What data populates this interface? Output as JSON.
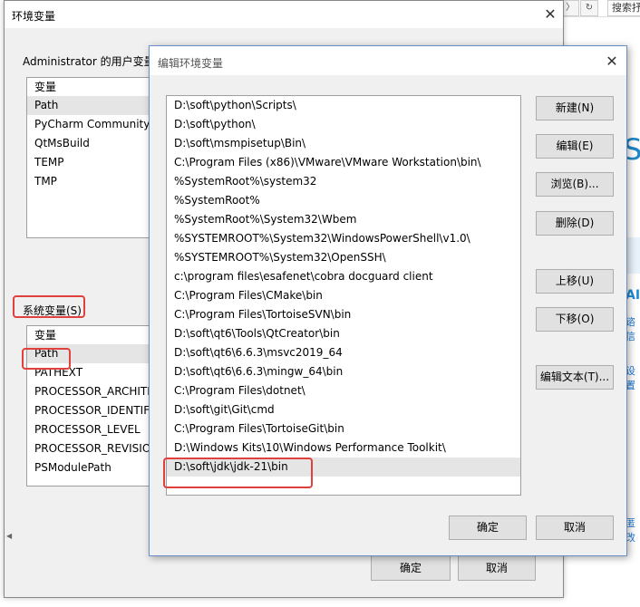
{
  "background": {
    "back_glyph": "〉",
    "refresh_glyph": "↻",
    "search_text": "搜索抒",
    "big_letter": "S",
    "ai_text": "AI",
    "link1": "谘信",
    "link2": "设置",
    "link3": "匿改"
  },
  "outer_dialog": {
    "title": "环境变量",
    "user_section_label": "Administrator 的用户变量",
    "user_vars_header": "变量",
    "user_vars": [
      "Path",
      "PyCharm Community E",
      "QtMsBuild",
      "TEMP",
      "TMP"
    ],
    "system_section_label": "系统变量(S)",
    "system_vars_header": "变量",
    "system_vars": [
      "Path",
      "PATHEXT",
      "PROCESSOR_ARCHITE",
      "PROCESSOR_IDENTIFI",
      "PROCESSOR_LEVEL",
      "PROCESSOR_REVISION",
      "PSModulePath"
    ],
    "ok_label": "确定",
    "cancel_label": "取消"
  },
  "edit_dialog": {
    "title": "编辑环境变量",
    "paths": [
      "D:\\soft\\python\\Scripts\\",
      "D:\\soft\\python\\",
      "D:\\soft\\msmpisetup\\Bin\\",
      "C:\\Program Files (x86)\\VMware\\VMware Workstation\\bin\\",
      "%SystemRoot%\\system32",
      "%SystemRoot%",
      "%SystemRoot%\\System32\\Wbem",
      "%SYSTEMROOT%\\System32\\WindowsPowerShell\\v1.0\\",
      "%SYSTEMROOT%\\System32\\OpenSSH\\",
      "c:\\program files\\esafenet\\cobra docguard client",
      "C:\\Program Files\\CMake\\bin",
      "C:\\Program Files\\TortoiseSVN\\bin",
      "D:\\soft\\qt6\\Tools\\QtCreator\\bin",
      "D:\\soft\\qt6\\6.6.3\\msvc2019_64",
      "D:\\soft\\qt6\\6.6.3\\mingw_64\\bin",
      "C:\\Program Files\\dotnet\\",
      "D:\\soft\\git\\Git\\cmd",
      "C:\\Program Files\\TortoiseGit\\bin",
      "D:\\Windows Kits\\10\\Windows Performance Toolkit\\",
      "D:\\soft\\jdk\\jdk-21\\bin"
    ],
    "buttons": {
      "new": "新建(N)",
      "edit": "编辑(E)",
      "browse": "浏览(B)...",
      "delete": "删除(D)",
      "move_up": "上移(U)",
      "move_down": "下移(O)",
      "edit_text": "编辑文本(T)..."
    },
    "ok_label": "确定",
    "cancel_label": "取消"
  },
  "colors": {
    "highlight_box": "#e0413c",
    "selection": "#e5e5e5",
    "accent": "#1f86c7"
  }
}
